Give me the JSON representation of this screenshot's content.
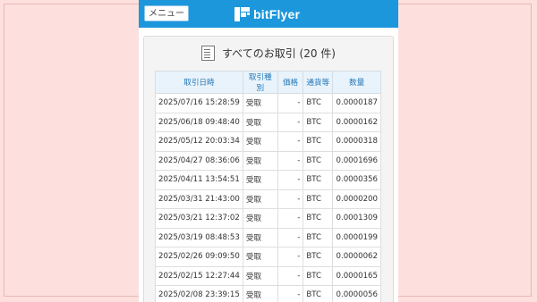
{
  "header": {
    "menu_label": "メニュー",
    "logo_text": "bitFlyer",
    "color": "#1c97dc"
  },
  "panel": {
    "title": "すべてのお取引 (20 件)"
  },
  "table": {
    "columns": [
      "取引日時",
      "取引種別",
      "価格",
      "通貨等",
      "数量"
    ],
    "rows": [
      [
        "2025/07/16 15:28:59",
        "受取",
        "-",
        "BTC",
        "0.0000187"
      ],
      [
        "2025/06/18 09:48:40",
        "受取",
        "-",
        "BTC",
        "0.0000162"
      ],
      [
        "2025/05/12 20:03:34",
        "受取",
        "-",
        "BTC",
        "0.0000318"
      ],
      [
        "2025/04/27 08:36:06",
        "受取",
        "-",
        "BTC",
        "0.0001696"
      ],
      [
        "2025/04/11 13:54:51",
        "受取",
        "-",
        "BTC",
        "0.0000356"
      ],
      [
        "2025/03/31 21:43:00",
        "受取",
        "-",
        "BTC",
        "0.0000200"
      ],
      [
        "2025/03/21 12:37:02",
        "受取",
        "-",
        "BTC",
        "0.0001309"
      ],
      [
        "2025/03/19 08:48:53",
        "受取",
        "-",
        "BTC",
        "0.0000199"
      ],
      [
        "2025/02/26 09:09:50",
        "受取",
        "-",
        "BTC",
        "0.0000062"
      ],
      [
        "2025/02/15 12:27:44",
        "受取",
        "-",
        "BTC",
        "0.0000165"
      ],
      [
        "2025/02/08 23:39:15",
        "受取",
        "-",
        "BTC",
        "0.0000056"
      ]
    ]
  }
}
